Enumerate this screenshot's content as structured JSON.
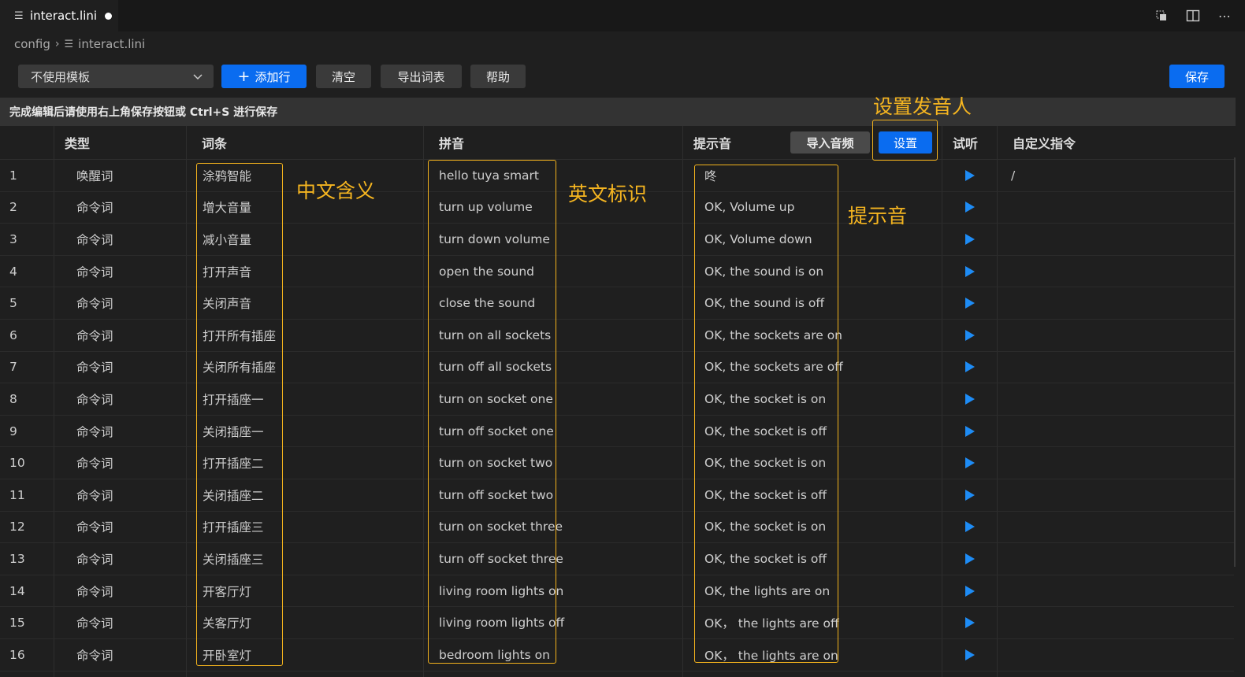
{
  "tab": {
    "label": "interact.lini"
  },
  "breadcrumb": {
    "folder": "config",
    "file": "interact.lini"
  },
  "toolbar": {
    "template_select": "不使用模板",
    "add_row": "添加行",
    "clear": "清空",
    "export": "导出词表",
    "help": "帮助",
    "save": "保存"
  },
  "notice": "完成编辑后请使用右上角保存按钮或 Ctrl+S 进行保存",
  "table": {
    "headers": {
      "type": "类型",
      "term": "词条",
      "pinyin": "拼音",
      "tone": "提示音",
      "import_audio": "导入音频",
      "settings": "设置",
      "listen": "试听",
      "custom": "自定义指令"
    },
    "rows": [
      {
        "idx": "1",
        "type": "唤醒词",
        "term": "涂鸦智能",
        "pinyin": "hello tuya smart",
        "tone": "咚",
        "custom": "/"
      },
      {
        "idx": "2",
        "type": "命令词",
        "term": "增大音量",
        "pinyin": "turn up volume",
        "tone": "OK, Volume up",
        "custom": ""
      },
      {
        "idx": "3",
        "type": "命令词",
        "term": "减小音量",
        "pinyin": "turn down volume",
        "tone": "OK, Volume down",
        "custom": ""
      },
      {
        "idx": "4",
        "type": "命令词",
        "term": "打开声音",
        "pinyin": "open the sound",
        "tone": "OK, the sound is on",
        "custom": ""
      },
      {
        "idx": "5",
        "type": "命令词",
        "term": "关闭声音",
        "pinyin": "close the sound",
        "tone": "OK, the sound is off",
        "custom": ""
      },
      {
        "idx": "6",
        "type": "命令词",
        "term": "打开所有插座",
        "pinyin": "turn on all sockets",
        "tone": "OK, the sockets are on",
        "custom": ""
      },
      {
        "idx": "7",
        "type": "命令词",
        "term": "关闭所有插座",
        "pinyin": "turn off all sockets",
        "tone": "OK, the sockets are off",
        "custom": ""
      },
      {
        "idx": "8",
        "type": "命令词",
        "term": "打开插座一",
        "pinyin": "turn on socket one",
        "tone": "OK, the socket is on",
        "custom": ""
      },
      {
        "idx": "9",
        "type": "命令词",
        "term": "关闭插座一",
        "pinyin": "turn off socket one",
        "tone": "OK, the socket is off",
        "custom": ""
      },
      {
        "idx": "10",
        "type": "命令词",
        "term": "打开插座二",
        "pinyin": "turn on socket two",
        "tone": "OK, the socket is on",
        "custom": ""
      },
      {
        "idx": "11",
        "type": "命令词",
        "term": "关闭插座二",
        "pinyin": "turn off socket two",
        "tone": "OK, the socket is off",
        "custom": ""
      },
      {
        "idx": "12",
        "type": "命令词",
        "term": "打开插座三",
        "pinyin": "turn on socket three",
        "tone": "OK, the socket is on",
        "custom": ""
      },
      {
        "idx": "13",
        "type": "命令词",
        "term": "关闭插座三",
        "pinyin": "turn off socket three",
        "tone": "OK, the socket is off",
        "custom": ""
      },
      {
        "idx": "14",
        "type": "命令词",
        "term": "开客厅灯",
        "pinyin": "living room lights on",
        "tone": "OK, the lights are on",
        "custom": ""
      },
      {
        "idx": "15",
        "type": "命令词",
        "term": "关客厅灯",
        "pinyin": "living room lights off",
        "tone": "OK， the lights are off",
        "custom": ""
      },
      {
        "idx": "16",
        "type": "命令词",
        "term": "开卧室灯",
        "pinyin": "bedroom lights on",
        "tone": "OK， the lights are on",
        "custom": ""
      }
    ]
  },
  "annotations": {
    "speaker": "设置发音人",
    "chinese": "中文含义",
    "english": "英文标识",
    "tone": "提示音"
  },
  "colors": {
    "accent": "#0a6cf0",
    "annotation": "#f5b520",
    "play": "#1e8cf5"
  },
  "icons": [
    "file-icon",
    "chevron-right-icon",
    "chevron-down-icon",
    "plus-icon",
    "play-icon",
    "copy-icon",
    "split-editor-icon",
    "more-icon"
  ]
}
